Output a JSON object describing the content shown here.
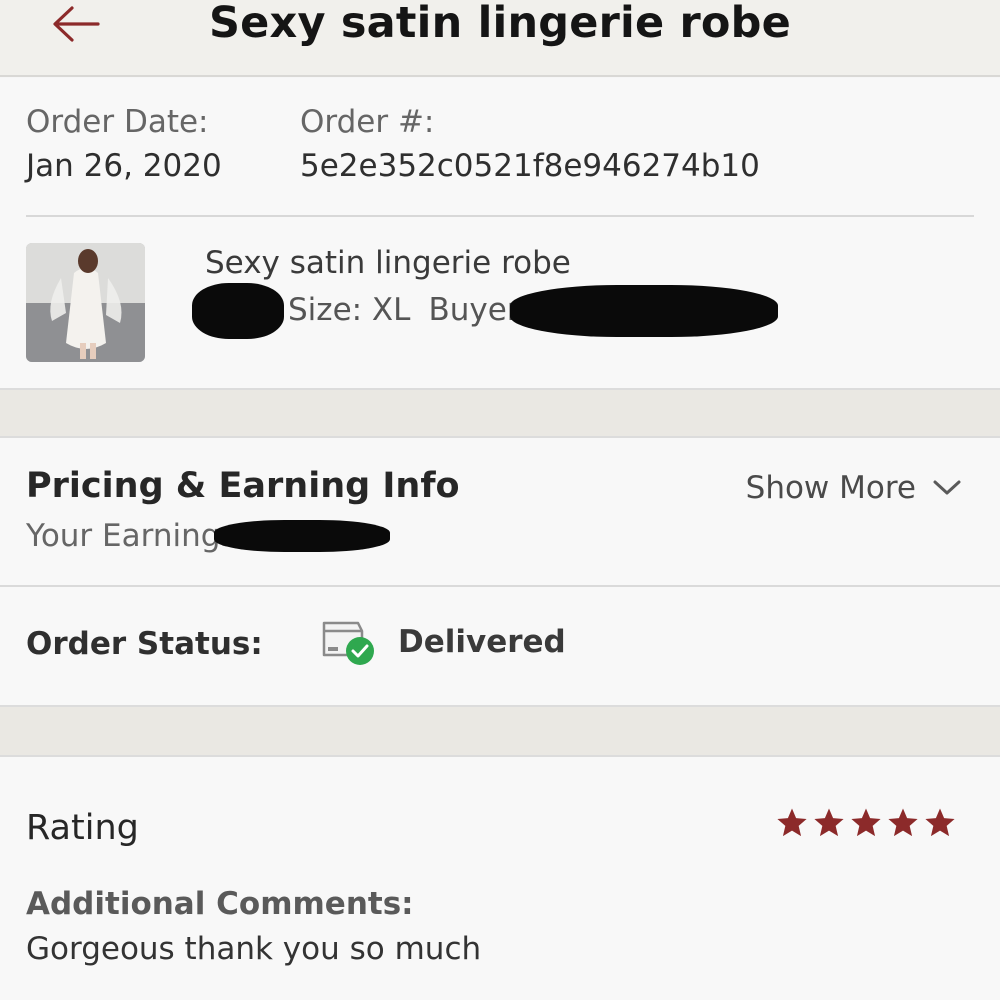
{
  "header": {
    "title": "Sexy satin lingerie robe",
    "back_icon": "arrow-left-icon"
  },
  "order": {
    "date_label": "Order Date:",
    "date_value": "Jan 26, 2020",
    "number_label": "Order #:",
    "number_value": "5e2e352c0521f8e946274b10"
  },
  "item": {
    "title": "Sexy satin lingerie robe",
    "size": "Size: XL",
    "buyer_label": "Buyer:"
  },
  "pricing": {
    "heading": "Pricing & Earning Info",
    "earnings_label": "Your Earnings:",
    "show_more": "Show More",
    "show_more_icon": "chevron-down-icon"
  },
  "status": {
    "label": "Order Status:",
    "value": "Delivered",
    "icon": "package-delivered-icon"
  },
  "rating": {
    "heading": "Rating",
    "stars": 5,
    "max_stars": 5,
    "comments_label": "Additional Comments:",
    "comments": "Gorgeous thank you so much"
  },
  "colors": {
    "accent": "#8c2a2a",
    "header_bg": "#f1f0ec",
    "band_bg": "#eae8e3",
    "success": "#34a853"
  }
}
